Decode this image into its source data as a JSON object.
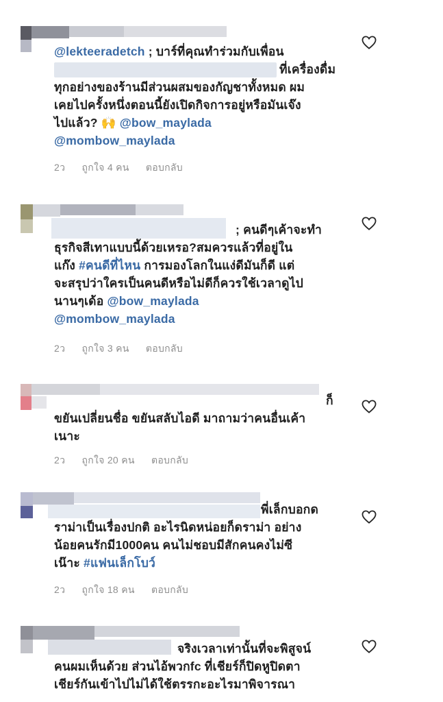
{
  "comments": [
    {
      "lines": [
        {
          "mention": "@lekteeradetch",
          "rest": " ; บาร์ที่คุณทำร่วมกับเพื่อน"
        },
        {
          "rest": "ที่เครื่องดื่ม"
        },
        {
          "rest": "ทุกอย่างของร้านมีส่วนผสมของกัญชาทั้งหมด ผม"
        },
        {
          "rest": "เคยไปครั้งหนึ่งตอนนี้ยังเปิดกิจการอยู่หรือมันเจ๊ง"
        },
        {
          "rest": "ไปแล้ว? 🙌 ",
          "mention": "@bow_maylada"
        },
        {
          "mention": "@mombow_maylada"
        }
      ],
      "time": "2ว",
      "likes": "ถูกใจ 4 คน",
      "reply": "ตอบกลับ"
    },
    {
      "lines": [
        {
          "rest": "; คนดีๆเค้าจะทำ"
        },
        {
          "rest": "ธุรกิจสีเทาแบบนี้ด้วยเหรอ?สมควรแล้วที่อยู่ใน"
        },
        {
          "rest": "แก๊ง ",
          "tag": "#คนดีที่ไหน",
          "rest2": " การมองโลกในแง่ดีมันก็ดี แต่"
        },
        {
          "rest": "จะสรุปว่าใครเป็นคนดีหรือไม่ดีก็ควรใช้เวลาดูไป"
        },
        {
          "rest": "นานๆเด้อ ",
          "mention": "@bow_maylada"
        },
        {
          "mention": "@mombow_maylada"
        }
      ],
      "time": "2ว",
      "likes": "ถูกใจ 3 คน",
      "reply": "ตอบกลับ"
    },
    {
      "lines": [
        {
          "rest": "ก็"
        },
        {
          "rest": "ขยันเปลี่ยนชื่อ ขยันสลับไอดี มาถามว่าคนอื่นเค้า"
        },
        {
          "rest": "เนาะ"
        }
      ],
      "time": "2ว",
      "likes": "ถูกใจ 20 คน",
      "reply": "ตอบกลับ"
    },
    {
      "lines": [
        {
          "rest": "พี่เล็กบอกด"
        },
        {
          "rest": "ราม่าเป็นเรื่องปกติ อะไรนิดหน่อยก็ดราม่า  อย่าง"
        },
        {
          "rest": "น้อยคนรักมี1000คน คนไม่ชอบมีสักคนคงไม่ซี"
        },
        {
          "rest": "เน๊าะ ",
          "tag": "#แฟนเล็กโบว์"
        }
      ],
      "time": "2ว",
      "likes": "ถูกใจ 18 คน",
      "reply": "ตอบกลับ"
    },
    {
      "lines": [
        {
          "rest": "จริงเวลาเท่านั้นที่จะพิสูจน์"
        },
        {
          "rest": "คนผมเห็นด้วย ส่วนไอ้พวกfc ที่เชียร์ก็ปิดหูปิดตา"
        },
        {
          "rest": "เชียร์กันเข้าไปไม่ได้ใช้ตรรกะอะไรมาพิจารณา"
        }
      ]
    }
  ],
  "icons": {
    "heart": "heart-outline-icon"
  },
  "colors": {
    "mention": "#3a6aa5",
    "meta": "#8e8e8e",
    "text": "#1f1f1f"
  }
}
